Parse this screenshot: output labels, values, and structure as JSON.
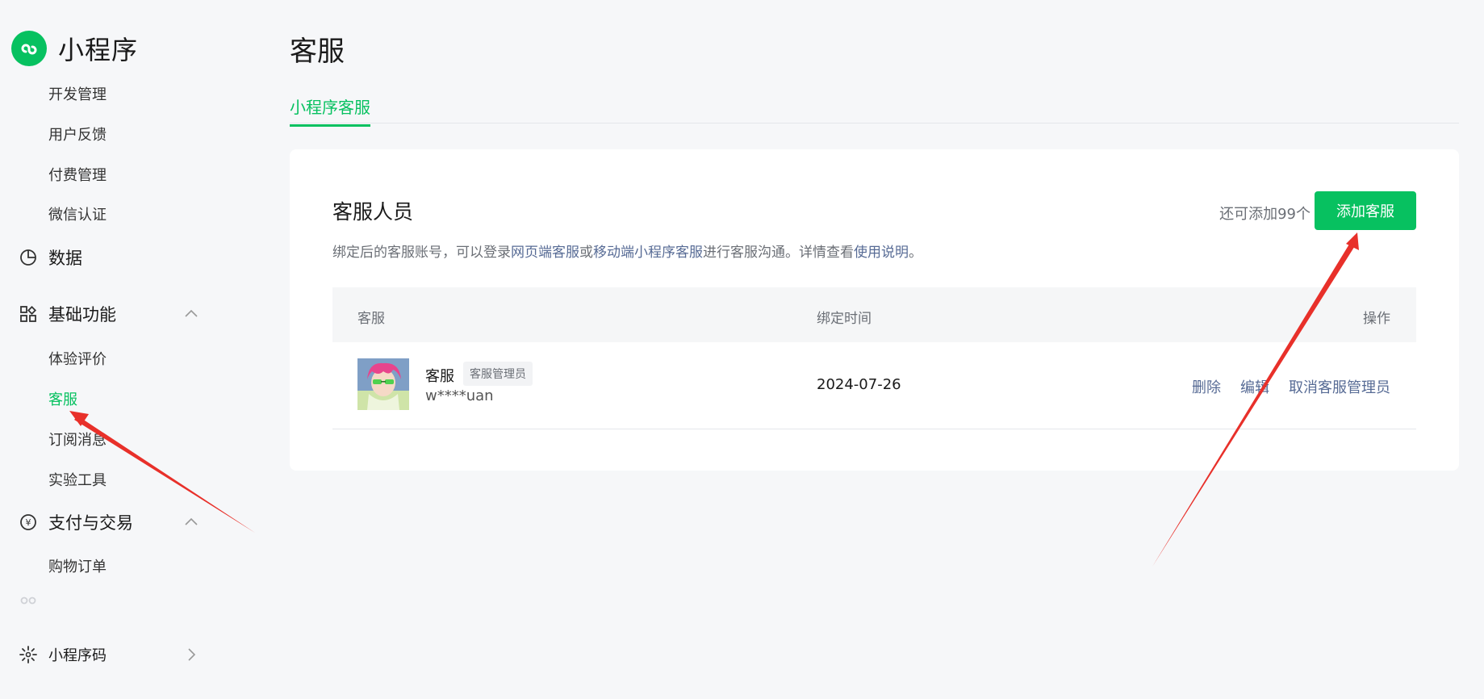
{
  "brand": {
    "name": "小程序",
    "logo_icon": "mini-program-logo-icon",
    "color": "#07c160"
  },
  "sidebar": {
    "top_items": [
      {
        "label": "开发管理"
      },
      {
        "label": "用户反馈"
      },
      {
        "label": "付费管理"
      },
      {
        "label": "微信认证"
      }
    ],
    "data_group": {
      "label": "数据",
      "icon": "pie-chart-icon"
    },
    "basic_group": {
      "label": "基础功能",
      "icon": "grid-apps-icon",
      "expanded": true,
      "items": [
        {
          "label": "体验评价"
        },
        {
          "label": "客服",
          "active": true
        },
        {
          "label": "订阅消息"
        },
        {
          "label": "实验工具"
        }
      ]
    },
    "payment_group": {
      "label": "支付与交易",
      "icon": "yen-circle-icon",
      "expanded": true,
      "items": [
        {
          "label": "购物订单"
        }
      ]
    },
    "code_item": {
      "label": "小程序码",
      "icon": "qr-burst-icon"
    }
  },
  "main": {
    "title": "客服",
    "tabs": [
      {
        "label": "小程序客服",
        "active": true
      }
    ],
    "card": {
      "title": "客服人员",
      "desc_parts": [
        "绑定后的客服账号，可以登录",
        "网页端客服",
        "或",
        "移动端小程序客服",
        "进行客服沟通。详情查看",
        "使用说明",
        "。"
      ],
      "remain_text": "还可添加99个",
      "add_button": "添加客服",
      "table": {
        "headers": [
          "客服",
          "绑定时间",
          "操作"
        ],
        "rows": [
          {
            "name": "客服",
            "role": "客服管理员",
            "account": "w****uan",
            "bind_time": "2024-07-26",
            "actions": [
              "删除",
              "编辑",
              "取消客服管理员"
            ]
          }
        ]
      }
    }
  },
  "colors": {
    "accent": "#07c160",
    "link": "#576b95",
    "annotation_arrow": "#e8302a"
  }
}
